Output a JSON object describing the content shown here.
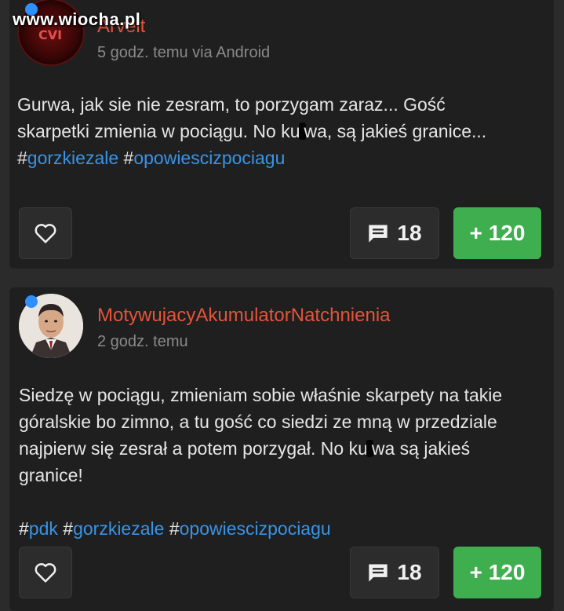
{
  "watermark": "www.wiocha.pl",
  "posts": [
    {
      "username": "Arvelt",
      "time_meta": "5 godz. temu via Android",
      "body_lines": [
        "Gurwa, jak sie nie zesram, to porzygam zaraz... Gość skarpetki zmienia w pociągu. No ku",
        "wa, są jakieś granice..."
      ],
      "tags": [
        "gorzkiezale",
        "opowiescizpociagu"
      ],
      "comments": "18",
      "votes": "+ 120"
    },
    {
      "username": "MotywujacyAkumulatorNatchnienia",
      "time_meta": "2 godz. temu",
      "body_lines": [
        "Siedzę w pociągu, zmieniam sobie właśnie skarpety na takie góralskie bo zimno, a tu gość co siedzi ze mną w przedziale najpierw się zesrał a potem porzygał. No ku",
        "wa są jakieś granice!"
      ],
      "tags": [
        "pdk",
        "gorzkiezale",
        "opowiescizpociagu"
      ],
      "comments": "18",
      "votes": "+ 120"
    }
  ],
  "colors": {
    "username": "#e4543a",
    "hashtag": "#3a93e6",
    "vote_green": "#3fae4f",
    "online_dot": "#2f8fff"
  },
  "icons": {
    "like": "heart-outline-icon",
    "comment": "comment-bubble-icon"
  }
}
